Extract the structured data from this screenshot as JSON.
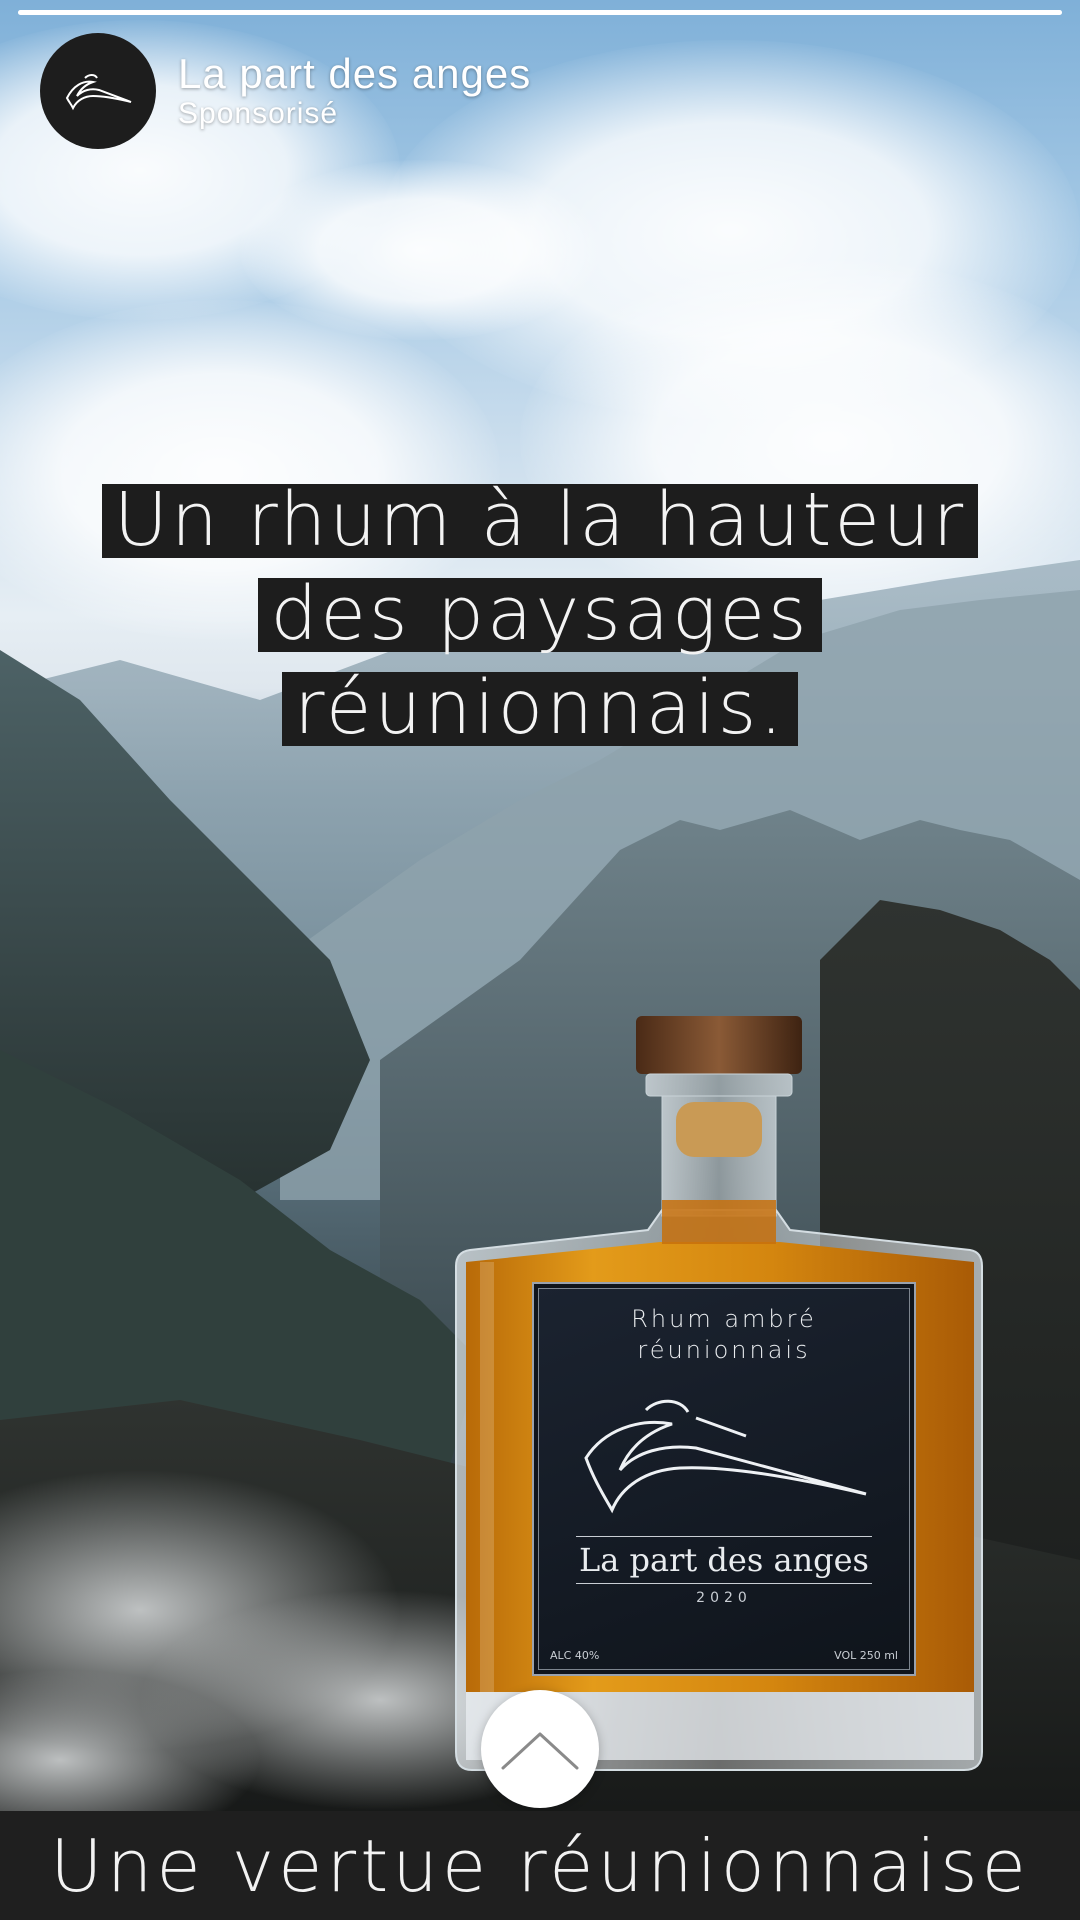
{
  "story": {
    "progress_fraction": 1.0
  },
  "header": {
    "brand_name": "La part des anges",
    "sponsored_label": "Sponsorisé",
    "avatar_icon": "angel-bird-logo-icon"
  },
  "headline": {
    "lines": [
      "Un rhum à la hauteur",
      "des paysages",
      "réunionnais."
    ]
  },
  "bottle_label": {
    "type_line1": "Rhum ambré",
    "type_line2": "réunionnais",
    "brand": "La part des anges",
    "year": "2020",
    "alc": "ALC 40%",
    "vol": "VOL 250 ml",
    "logo_icon": "angel-bird-logo-icon"
  },
  "swipe_up": {
    "icon": "chevron-up-icon"
  },
  "footer": {
    "tagline": "Une vertue réunionnaise"
  },
  "colors": {
    "bar_background": "#1f1f1f",
    "text_light": "#f2f2f2",
    "rum_amber": "#d48a10"
  }
}
